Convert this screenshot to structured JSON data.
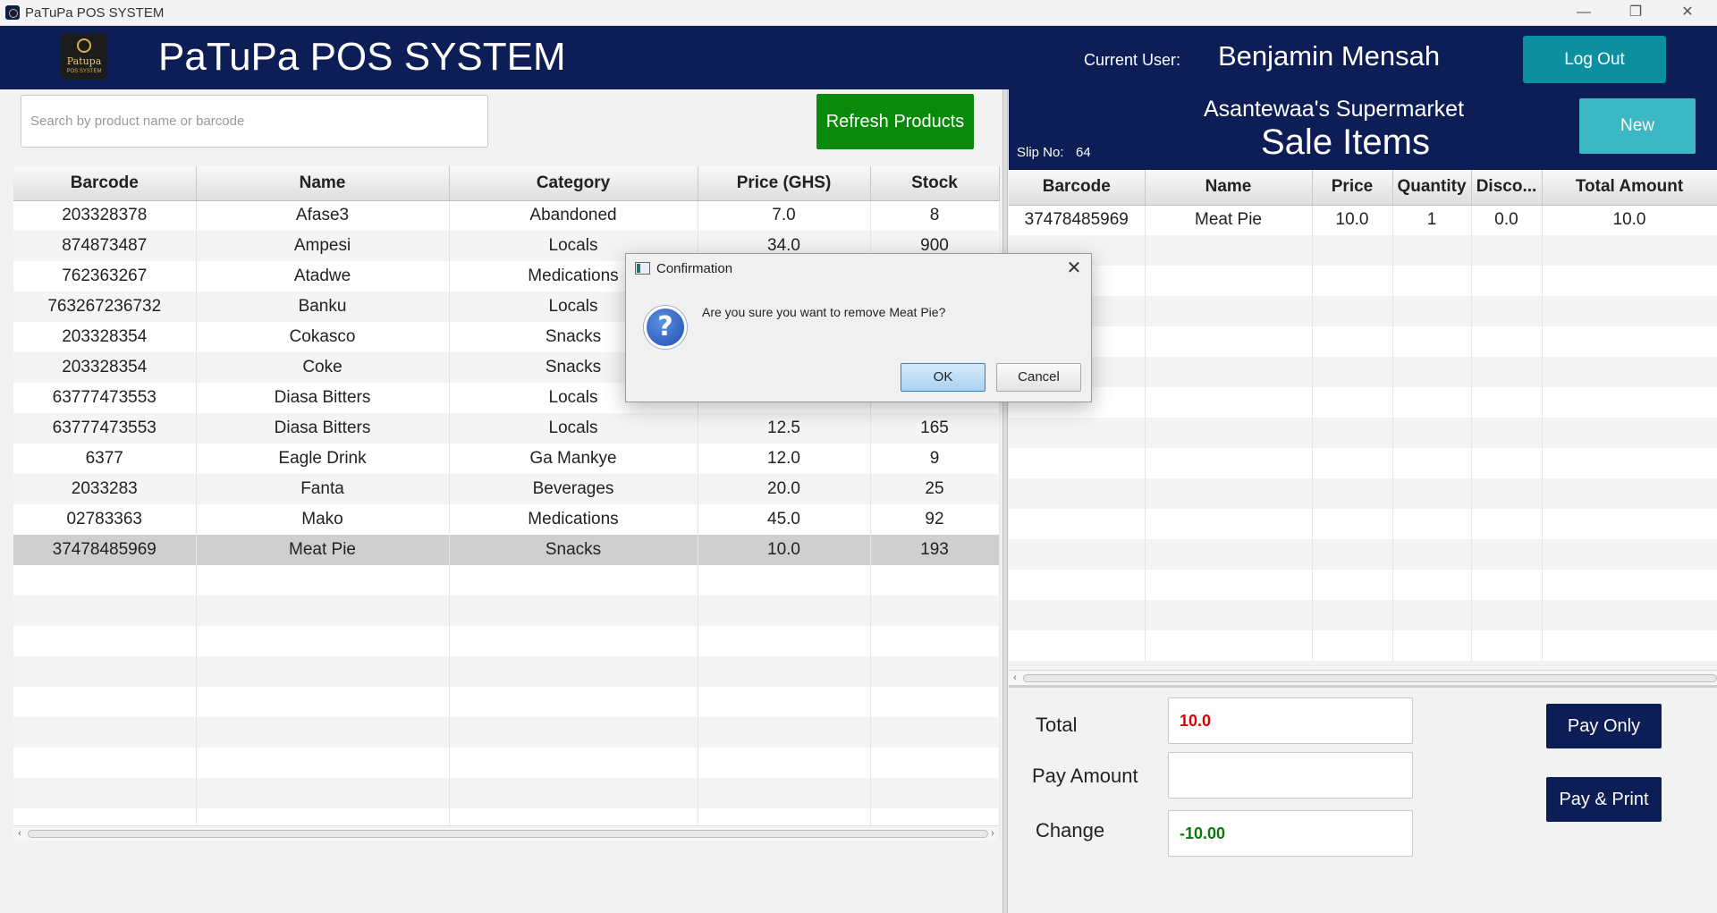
{
  "window": {
    "title": "PaTuPa POS SYSTEM",
    "minimize": "—",
    "maximize": "❐",
    "close": "✕"
  },
  "header": {
    "logo_text": "Patupa",
    "logo_subtext": "POS SYSTEM",
    "app_title": "PaTuPa POS SYSTEM",
    "current_user_label": "Current User:",
    "current_user": "Benjamin Mensah",
    "logout_label": "Log Out"
  },
  "search": {
    "placeholder": "Search by product name or barcode",
    "value": ""
  },
  "refresh_label": "Refresh Products",
  "products": {
    "columns": [
      "Barcode",
      "Name",
      "Category",
      "Price (GHS)",
      "Stock"
    ],
    "rows": [
      [
        "203328378",
        "Afase3",
        "Abandoned",
        "7.0",
        "8"
      ],
      [
        "874873487",
        "Ampesi",
        "Locals",
        "34.0",
        "900"
      ],
      [
        "762363267",
        "Atadwe",
        "Medications",
        "",
        ""
      ],
      [
        "763267236732",
        "Banku",
        "Locals",
        "",
        ""
      ],
      [
        "203328354",
        "Cokasco",
        "Snacks",
        "",
        ""
      ],
      [
        "203328354",
        "Coke",
        "Snacks",
        "",
        ""
      ],
      [
        "63777473553",
        "Diasa Bitters",
        "Locals",
        "12.5",
        "165"
      ],
      [
        "63777473553",
        "Diasa Bitters",
        "Locals",
        "12.5",
        "165"
      ],
      [
        "6377",
        "Eagle Drink",
        "Ga Mankye",
        "12.0",
        "9"
      ],
      [
        "2033283",
        "Fanta",
        "Beverages",
        "20.0",
        "25"
      ],
      [
        "02783363",
        "Mako",
        "Medications",
        "45.0",
        "92"
      ],
      [
        "37478485969",
        "Meat Pie",
        "Snacks",
        "10.0",
        "193"
      ]
    ],
    "selected_row": 11,
    "empty_rows": 9
  },
  "sale": {
    "store_name": "Asantewaa's Supermarket",
    "title": "Sale Items",
    "slip_label": "Slip No:",
    "slip_no": "64",
    "new_label": "New",
    "columns": [
      "Barcode",
      "Name",
      "Price",
      "Quantity",
      "Disco...",
      "Total Amount"
    ],
    "rows": [
      [
        "37478485969",
        "Meat Pie",
        "10.0",
        "1",
        "0.0",
        "10.0"
      ]
    ],
    "empty_rows": 14
  },
  "totals": {
    "total_label": "Total",
    "total_value": "10.0",
    "pay_amount_label": "Pay Amount",
    "pay_amount_value": "",
    "change_label": "Change",
    "change_value": "-10.00",
    "pay_only_label": "Pay Only",
    "pay_print_label": "Pay & Print"
  },
  "dialog": {
    "title": "Confirmation",
    "close": "✕",
    "icon_glyph": "?",
    "message": "Are you sure you want to remove Meat Pie?",
    "ok_label": "OK",
    "cancel_label": "Cancel"
  },
  "colors": {
    "header_bg": "#0d1d56",
    "logout_bg": "#0e8fa0",
    "refresh_bg": "#0a8a0a",
    "new_bg": "#3bb8c3",
    "total_value": "#e00000",
    "change_value": "#0a7a0a"
  },
  "icons": {
    "app": "app-logo-icon",
    "dialog_app": "window-icon",
    "question": "question-icon"
  }
}
